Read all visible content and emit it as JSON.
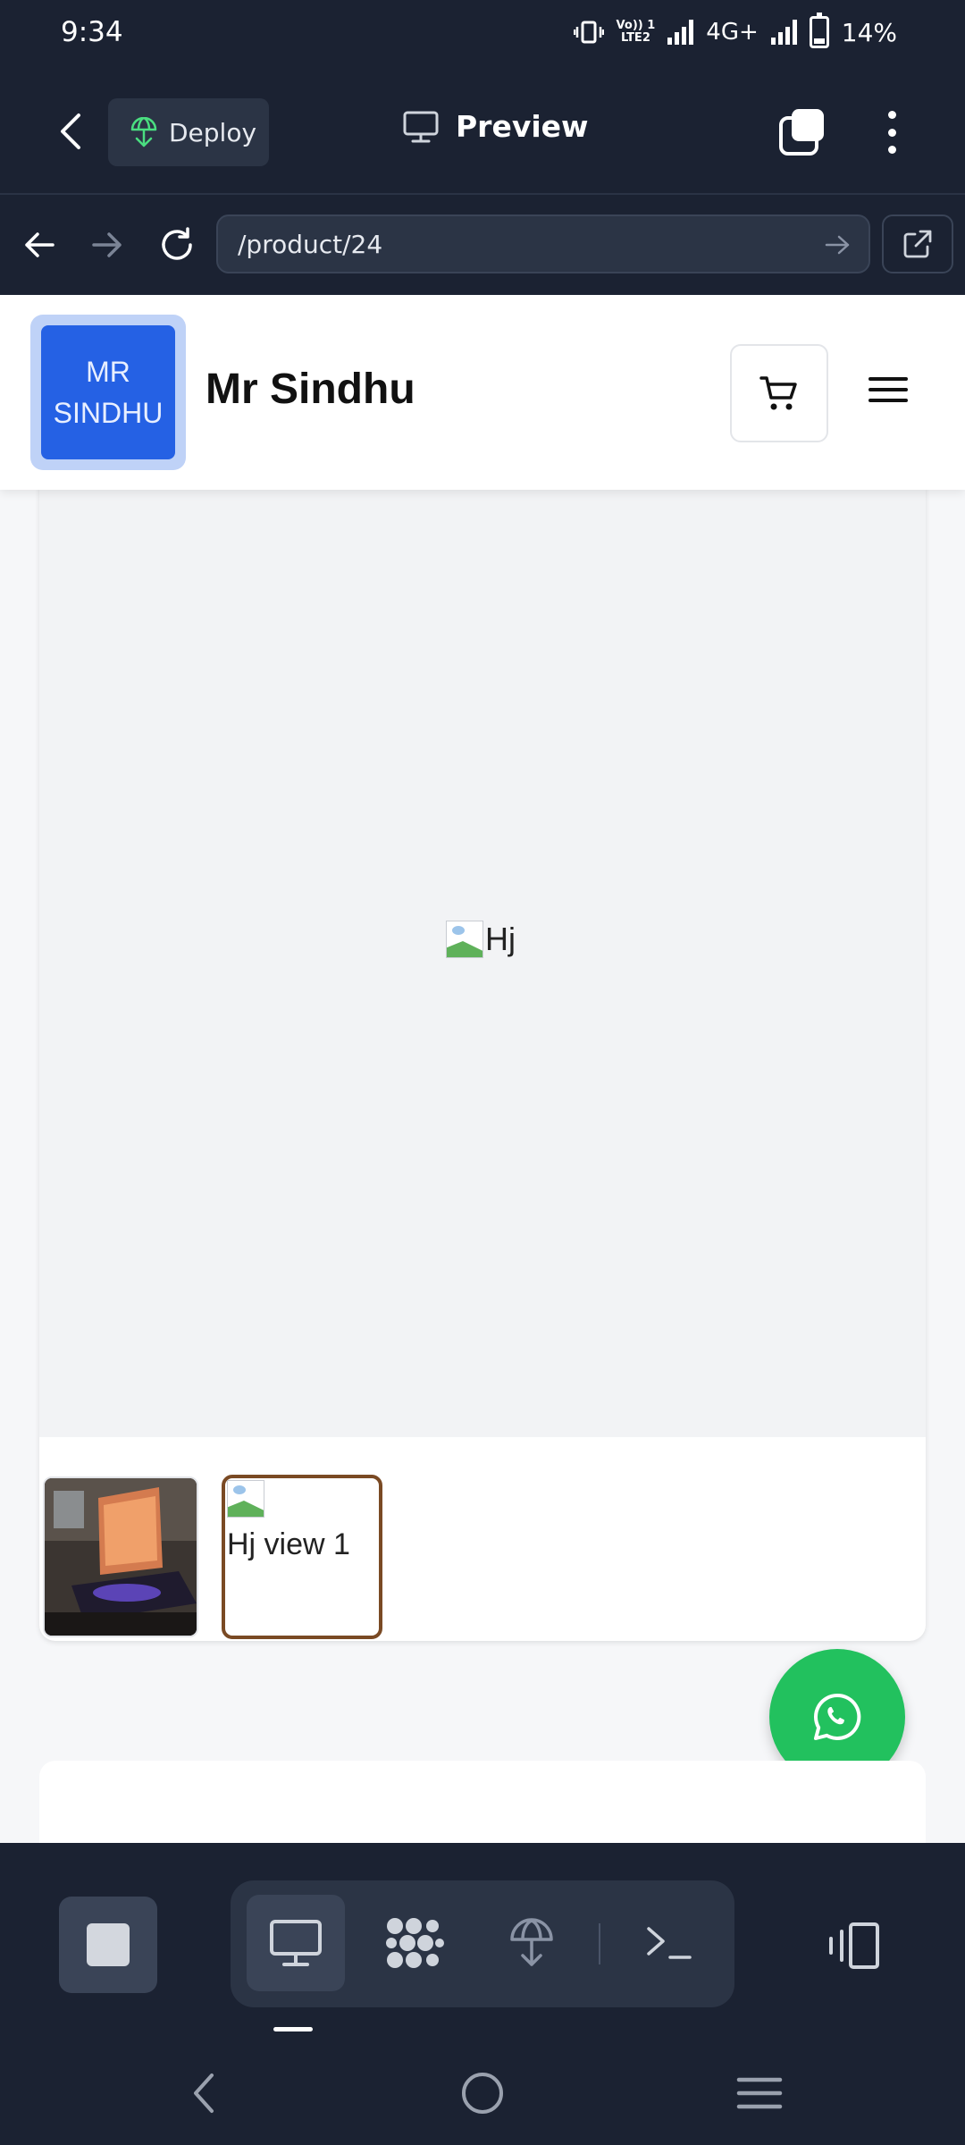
{
  "status_bar": {
    "time": "9:34",
    "network": "4G+",
    "battery": "14%",
    "lte_line1": "Vo)) 1",
    "lte_line2": "LTE2"
  },
  "app_header": {
    "deploy_label": "Deploy",
    "title": "Preview"
  },
  "url_bar": {
    "value": "/product/24"
  },
  "site": {
    "logo_line1": "MR",
    "logo_line2": "SINDHU",
    "brand_name": "Mr Sindhu"
  },
  "product": {
    "main_image_alt": "Hj",
    "thumb2_alt": "Hj view 1"
  },
  "colors": {
    "app_bg": "#1b2232",
    "logo_blue": "#2561e4",
    "thumb_selected_border": "#7a4a24",
    "whatsapp_green": "#22c15e",
    "deploy_icon_green": "#4ade80"
  },
  "icons": [
    "back-arrow-icon",
    "deploy-icon",
    "monitor-icon",
    "tabs-icon",
    "more-vertical-icon",
    "arrow-left-icon",
    "arrow-right-icon",
    "reload-icon",
    "external-link-icon",
    "cart-icon",
    "hamburger-menu-icon",
    "whatsapp-icon",
    "stop-icon",
    "desktop-icon",
    "grid-dots-icon",
    "deploy-icon",
    "terminal-icon",
    "device-switch-icon",
    "nav-back-icon",
    "nav-home-icon",
    "nav-recents-icon"
  ]
}
